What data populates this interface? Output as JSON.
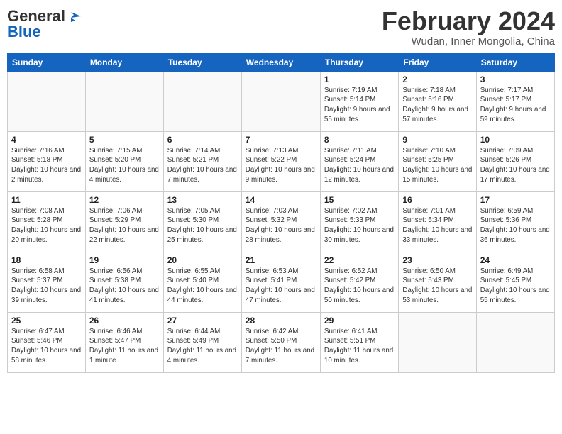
{
  "header": {
    "logo_general": "General",
    "logo_blue": "Blue",
    "month": "February 2024",
    "location": "Wudan, Inner Mongolia, China"
  },
  "days_of_week": [
    "Sunday",
    "Monday",
    "Tuesday",
    "Wednesday",
    "Thursday",
    "Friday",
    "Saturday"
  ],
  "weeks": [
    [
      {
        "day": "",
        "info": ""
      },
      {
        "day": "",
        "info": ""
      },
      {
        "day": "",
        "info": ""
      },
      {
        "day": "",
        "info": ""
      },
      {
        "day": "1",
        "sunrise": "Sunrise: 7:19 AM",
        "sunset": "Sunset: 5:14 PM",
        "daylight": "Daylight: 9 hours and 55 minutes."
      },
      {
        "day": "2",
        "sunrise": "Sunrise: 7:18 AM",
        "sunset": "Sunset: 5:16 PM",
        "daylight": "Daylight: 9 hours and 57 minutes."
      },
      {
        "day": "3",
        "sunrise": "Sunrise: 7:17 AM",
        "sunset": "Sunset: 5:17 PM",
        "daylight": "Daylight: 9 hours and 59 minutes."
      }
    ],
    [
      {
        "day": "4",
        "sunrise": "Sunrise: 7:16 AM",
        "sunset": "Sunset: 5:18 PM",
        "daylight": "Daylight: 10 hours and 2 minutes."
      },
      {
        "day": "5",
        "sunrise": "Sunrise: 7:15 AM",
        "sunset": "Sunset: 5:20 PM",
        "daylight": "Daylight: 10 hours and 4 minutes."
      },
      {
        "day": "6",
        "sunrise": "Sunrise: 7:14 AM",
        "sunset": "Sunset: 5:21 PM",
        "daylight": "Daylight: 10 hours and 7 minutes."
      },
      {
        "day": "7",
        "sunrise": "Sunrise: 7:13 AM",
        "sunset": "Sunset: 5:22 PM",
        "daylight": "Daylight: 10 hours and 9 minutes."
      },
      {
        "day": "8",
        "sunrise": "Sunrise: 7:11 AM",
        "sunset": "Sunset: 5:24 PM",
        "daylight": "Daylight: 10 hours and 12 minutes."
      },
      {
        "day": "9",
        "sunrise": "Sunrise: 7:10 AM",
        "sunset": "Sunset: 5:25 PM",
        "daylight": "Daylight: 10 hours and 15 minutes."
      },
      {
        "day": "10",
        "sunrise": "Sunrise: 7:09 AM",
        "sunset": "Sunset: 5:26 PM",
        "daylight": "Daylight: 10 hours and 17 minutes."
      }
    ],
    [
      {
        "day": "11",
        "sunrise": "Sunrise: 7:08 AM",
        "sunset": "Sunset: 5:28 PM",
        "daylight": "Daylight: 10 hours and 20 minutes."
      },
      {
        "day": "12",
        "sunrise": "Sunrise: 7:06 AM",
        "sunset": "Sunset: 5:29 PM",
        "daylight": "Daylight: 10 hours and 22 minutes."
      },
      {
        "day": "13",
        "sunrise": "Sunrise: 7:05 AM",
        "sunset": "Sunset: 5:30 PM",
        "daylight": "Daylight: 10 hours and 25 minutes."
      },
      {
        "day": "14",
        "sunrise": "Sunrise: 7:03 AM",
        "sunset": "Sunset: 5:32 PM",
        "daylight": "Daylight: 10 hours and 28 minutes."
      },
      {
        "day": "15",
        "sunrise": "Sunrise: 7:02 AM",
        "sunset": "Sunset: 5:33 PM",
        "daylight": "Daylight: 10 hours and 30 minutes."
      },
      {
        "day": "16",
        "sunrise": "Sunrise: 7:01 AM",
        "sunset": "Sunset: 5:34 PM",
        "daylight": "Daylight: 10 hours and 33 minutes."
      },
      {
        "day": "17",
        "sunrise": "Sunrise: 6:59 AM",
        "sunset": "Sunset: 5:36 PM",
        "daylight": "Daylight: 10 hours and 36 minutes."
      }
    ],
    [
      {
        "day": "18",
        "sunrise": "Sunrise: 6:58 AM",
        "sunset": "Sunset: 5:37 PM",
        "daylight": "Daylight: 10 hours and 39 minutes."
      },
      {
        "day": "19",
        "sunrise": "Sunrise: 6:56 AM",
        "sunset": "Sunset: 5:38 PM",
        "daylight": "Daylight: 10 hours and 41 minutes."
      },
      {
        "day": "20",
        "sunrise": "Sunrise: 6:55 AM",
        "sunset": "Sunset: 5:40 PM",
        "daylight": "Daylight: 10 hours and 44 minutes."
      },
      {
        "day": "21",
        "sunrise": "Sunrise: 6:53 AM",
        "sunset": "Sunset: 5:41 PM",
        "daylight": "Daylight: 10 hours and 47 minutes."
      },
      {
        "day": "22",
        "sunrise": "Sunrise: 6:52 AM",
        "sunset": "Sunset: 5:42 PM",
        "daylight": "Daylight: 10 hours and 50 minutes."
      },
      {
        "day": "23",
        "sunrise": "Sunrise: 6:50 AM",
        "sunset": "Sunset: 5:43 PM",
        "daylight": "Daylight: 10 hours and 53 minutes."
      },
      {
        "day": "24",
        "sunrise": "Sunrise: 6:49 AM",
        "sunset": "Sunset: 5:45 PM",
        "daylight": "Daylight: 10 hours and 55 minutes."
      }
    ],
    [
      {
        "day": "25",
        "sunrise": "Sunrise: 6:47 AM",
        "sunset": "Sunset: 5:46 PM",
        "daylight": "Daylight: 10 hours and 58 minutes."
      },
      {
        "day": "26",
        "sunrise": "Sunrise: 6:46 AM",
        "sunset": "Sunset: 5:47 PM",
        "daylight": "Daylight: 11 hours and 1 minute."
      },
      {
        "day": "27",
        "sunrise": "Sunrise: 6:44 AM",
        "sunset": "Sunset: 5:49 PM",
        "daylight": "Daylight: 11 hours and 4 minutes."
      },
      {
        "day": "28",
        "sunrise": "Sunrise: 6:42 AM",
        "sunset": "Sunset: 5:50 PM",
        "daylight": "Daylight: 11 hours and 7 minutes."
      },
      {
        "day": "29",
        "sunrise": "Sunrise: 6:41 AM",
        "sunset": "Sunset: 5:51 PM",
        "daylight": "Daylight: 11 hours and 10 minutes."
      },
      {
        "day": "",
        "info": ""
      },
      {
        "day": "",
        "info": ""
      }
    ]
  ]
}
